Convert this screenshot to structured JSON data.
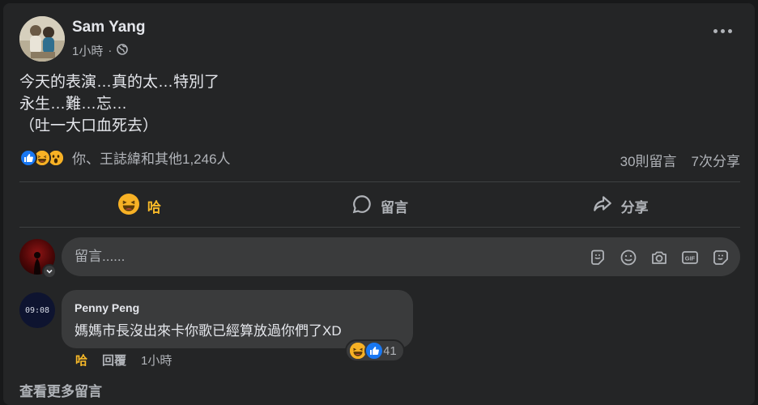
{
  "post": {
    "author": "Sam Yang",
    "time": "1小時",
    "privacy_icon": "globe-icon",
    "lines": [
      "今天的表演…真的太…特別了",
      "永生…難…忘…",
      "（吐一大口血死去）"
    ]
  },
  "stats": {
    "reaction_icons": [
      "like-icon",
      "haha-icon",
      "wow-icon"
    ],
    "reactions_text": "你、王誌緯和其他1,246人",
    "comments": "30則留言",
    "shares": "7次分享"
  },
  "actions": {
    "react_label": "哈",
    "comment_label": "留言",
    "share_label": "分享"
  },
  "composer": {
    "placeholder": "留言......",
    "icons": [
      "sticker-icon",
      "emoji-icon",
      "camera-icon",
      "gif-icon",
      "avatar-sticker-icon"
    ]
  },
  "comments": [
    {
      "author": "Penny Peng",
      "avatar_text": "09:08",
      "text": "媽媽市長沒出來卡你歌已經算放過你們了XD",
      "reaction_count": "41",
      "reaction_label": "哈",
      "reply_label": "回覆",
      "time": "1小時"
    }
  ],
  "view_more": "查看更多留言",
  "colors": {
    "card": "#242526",
    "bubble": "#3a3b3c",
    "accent_haha": "#f7b928",
    "like_blue": "#1877f2"
  }
}
